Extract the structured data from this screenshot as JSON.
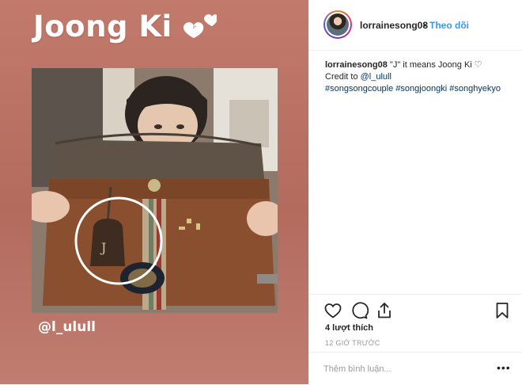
{
  "media": {
    "title": "Joong Ki",
    "credit": "@l_ulull",
    "colors": {
      "background": "#b86f62",
      "text": "#ffffff"
    }
  },
  "post": {
    "username": "lorrainesong08",
    "separator": "•",
    "follow_label": "Theo dõi",
    "caption": {
      "username": "lorrainesong08",
      "text": "\"J\" it means Joong Ki ♡",
      "credit_prefix": "Credit to",
      "credit_handle": "@l_ulull",
      "hashtags": [
        "#songsongcouple",
        "#songjoongki",
        "#songhyekyo"
      ]
    },
    "likes": "4 lượt thích",
    "timestamp": "12 GIỜ TRƯỚC",
    "comment_placeholder": "Thêm bình luận...",
    "more_label": "•••",
    "icons": [
      "heart-icon",
      "comment-icon",
      "share-icon",
      "bookmark-icon"
    ],
    "colors": {
      "link": "#3897f0",
      "hashtag": "#003569",
      "muted": "#999999"
    }
  }
}
